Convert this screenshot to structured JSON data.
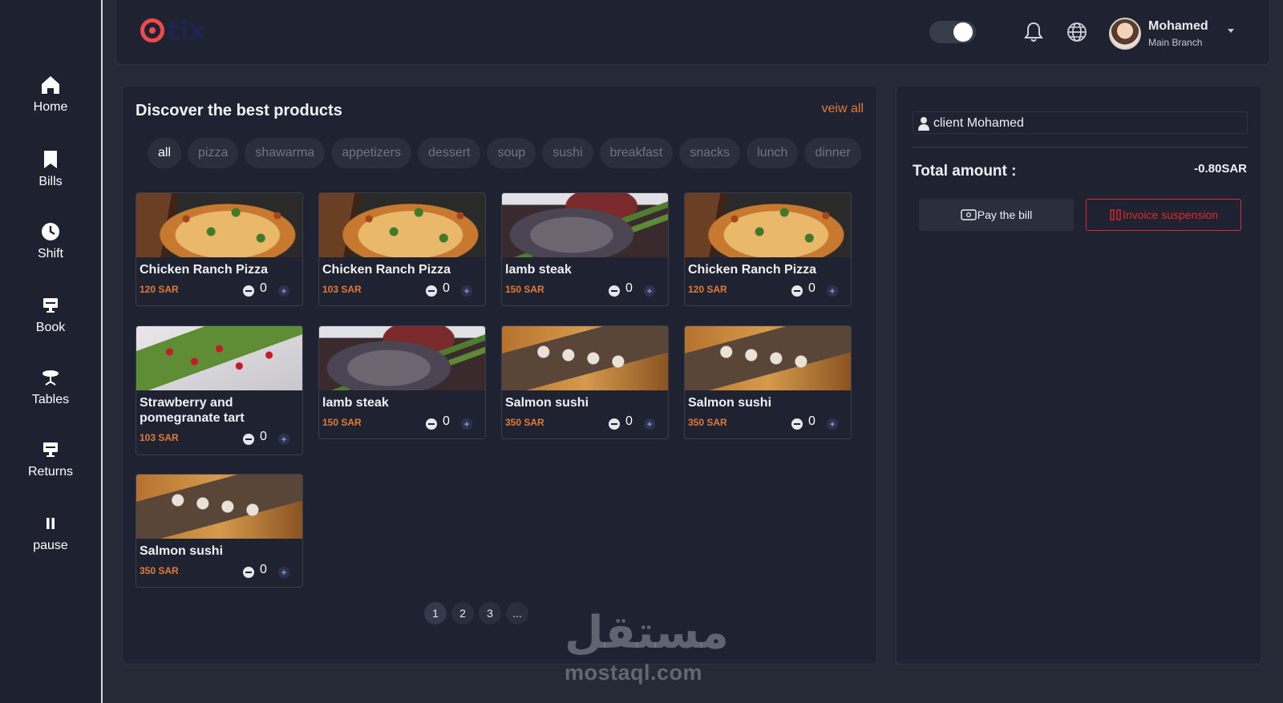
{
  "sidebar": {
    "items": [
      {
        "label": "Home",
        "icon": "home-icon"
      },
      {
        "label": "Bills",
        "icon": "bookmark-icon"
      },
      {
        "label": "Shift",
        "icon": "clock-icon"
      },
      {
        "label": "Book",
        "icon": "monitor-icon"
      },
      {
        "label": "Tables",
        "icon": "table-icon"
      },
      {
        "label": "Returns",
        "icon": "monitor-icon"
      },
      {
        "label": "pause",
        "icon": "pause-icon"
      }
    ]
  },
  "header": {
    "logo_text": "tix",
    "user": {
      "name": "Mohamed",
      "branch": "Main Branch"
    },
    "theme_toggle_on": true,
    "colors": {
      "logo_ring": "#f0494b",
      "logo_text": "#1b2650"
    }
  },
  "products": {
    "title": "Discover the best products",
    "view_all": "veiw all",
    "categories": [
      "all",
      "pizza",
      "shawarma",
      "appetizers",
      "dessert",
      "soup",
      "sushi",
      "breakfast",
      "snacks",
      "lunch",
      "dinner"
    ],
    "active_category": "all",
    "items": [
      {
        "name": "Chicken Ranch Pizza",
        "price": "120 SAR",
        "qty": "0",
        "image": "pizza"
      },
      {
        "name": "Chicken Ranch Pizza",
        "price": "103 SAR",
        "qty": "0",
        "image": "pizza"
      },
      {
        "name": "lamb steak",
        "price": "150 SAR",
        "qty": "0",
        "image": "steak"
      },
      {
        "name": "Chicken Ranch Pizza",
        "price": "120 SAR",
        "qty": "0",
        "image": "pizza"
      },
      {
        "name": "Strawberry and pomegranate tart",
        "price": "103 SAR",
        "qty": "0",
        "image": "tart"
      },
      {
        "name": "lamb steak",
        "price": "150 SAR",
        "qty": "0",
        "image": "steak"
      },
      {
        "name": "Salmon sushi",
        "price": "350 SAR",
        "qty": "0",
        "image": "sushi"
      },
      {
        "name": "Salmon sushi",
        "price": "350 SAR",
        "qty": "0",
        "image": "sushi"
      },
      {
        "name": "Salmon sushi",
        "price": "350 SAR",
        "qty": "0",
        "image": "sushi"
      }
    ],
    "pagination": [
      "1",
      "2",
      "3",
      "..."
    ],
    "current_page": "1"
  },
  "bill": {
    "client": "client Mohamed",
    "total_label": "Total amount :",
    "total_value": "-0.80SAR",
    "pay_label": "Pay the bill",
    "suspension_label": "Invoice suspension",
    "colors": {
      "accent": "#e27a37",
      "danger": "#e0282f"
    }
  },
  "watermark": {
    "arabic": "مستقل",
    "latin": "mostaql.com"
  }
}
